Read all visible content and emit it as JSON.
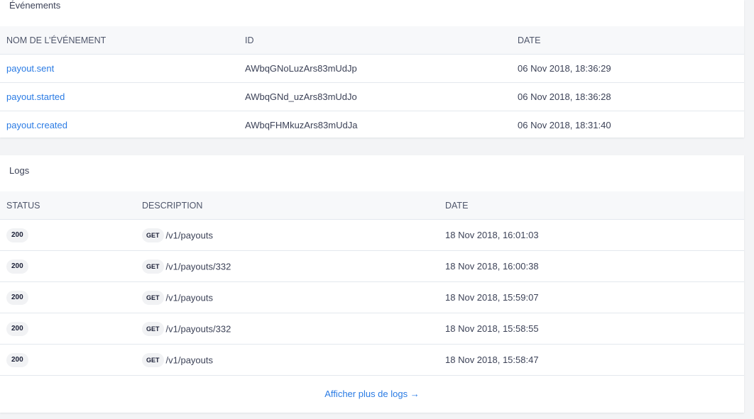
{
  "events": {
    "title": "Événements",
    "columns": {
      "name": "NOM DE L’ÉVÉNEMENT",
      "id": "ID",
      "date": "DATE"
    },
    "rows": [
      {
        "name": "payout.sent",
        "id": "AWbqGNoLuzArs83mUdJp",
        "date": "06 Nov 2018, 18:36:29"
      },
      {
        "name": "payout.started",
        "id": "AWbqGNd_uzArs83mUdJo",
        "date": "06 Nov 2018, 18:36:28"
      },
      {
        "name": "payout.created",
        "id": "AWbqFHMkuzArs83mUdJa",
        "date": "06 Nov 2018, 18:31:40"
      }
    ]
  },
  "logs": {
    "title": "Logs",
    "columns": {
      "status": "STATUS",
      "description": "DESCRIPTION",
      "date": "DATE"
    },
    "rows": [
      {
        "status": "200",
        "method": "GET",
        "path": "/v1/payouts",
        "date": "18 Nov 2018, 16:01:03"
      },
      {
        "status": "200",
        "method": "GET",
        "path": "/v1/payouts/332",
        "date": "18 Nov 2018, 16:00:38"
      },
      {
        "status": "200",
        "method": "GET",
        "path": "/v1/payouts",
        "date": "18 Nov 2018, 15:59:07"
      },
      {
        "status": "200",
        "method": "GET",
        "path": "/v1/payouts/332",
        "date": "18 Nov 2018, 15:58:55"
      },
      {
        "status": "200",
        "method": "GET",
        "path": "/v1/payouts",
        "date": "18 Nov 2018, 15:58:47"
      }
    ],
    "more_link": "Afficher plus de logs →"
  },
  "colors": {
    "link": "#2a7be4",
    "header_bg": "#f7f8fa",
    "border": "#e3e8ee",
    "badge_bg": "#f1f2f4"
  }
}
